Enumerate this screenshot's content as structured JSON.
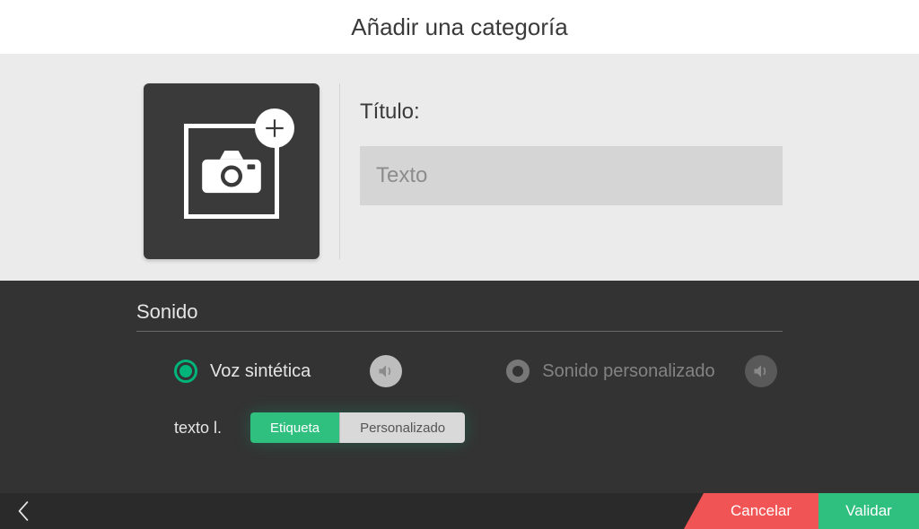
{
  "header": {
    "title": "Añadir una categoría"
  },
  "image_tile": {
    "icon": "camera-icon",
    "action_icon": "plus-icon"
  },
  "title_field": {
    "label": "Título:",
    "placeholder": "Texto",
    "value": ""
  },
  "sound": {
    "heading": "Sonido",
    "synthetic": {
      "label": "Voz sintética",
      "selected": true
    },
    "custom": {
      "label": "Sonido personalizado",
      "selected": false
    },
    "text_row": {
      "label": "texto l.",
      "segmented": {
        "option_a": "Etiqueta",
        "option_b": "Personalizado",
        "active": "a"
      }
    }
  },
  "footer": {
    "cancel": "Cancelar",
    "validate": "Validar"
  },
  "colors": {
    "accent": "#2fbf7f",
    "danger": "#f15454",
    "dark": "#333333"
  }
}
